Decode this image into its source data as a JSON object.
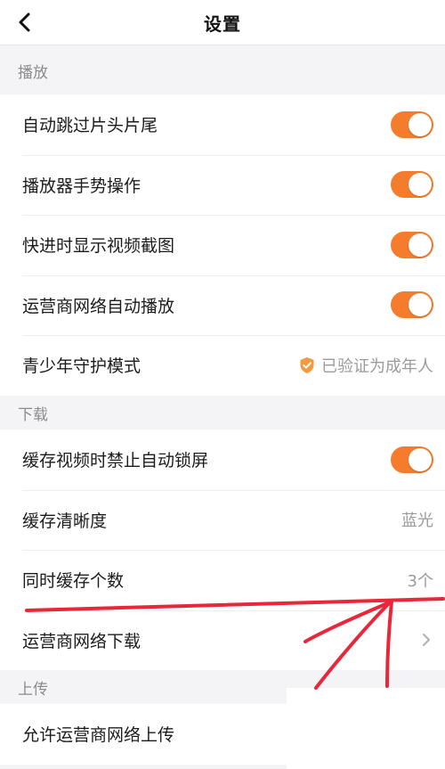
{
  "header": {
    "title": "设置"
  },
  "sections": {
    "playback": {
      "title": "播放",
      "items": [
        {
          "label": "自动跳过片头片尾",
          "toggle": true
        },
        {
          "label": "播放器手势操作",
          "toggle": true
        },
        {
          "label": "快进时显示视频截图",
          "toggle": true
        },
        {
          "label": "运营商网络自动播放",
          "toggle": true
        },
        {
          "label": "青少年守护模式",
          "value": "已验证为成年人",
          "icon": "shield-check-icon"
        }
      ]
    },
    "download": {
      "title": "下载",
      "items": [
        {
          "label": "缓存视频时禁止自动锁屏",
          "toggle": true
        },
        {
          "label": "缓存清晰度",
          "value": "蓝光"
        },
        {
          "label": "同时缓存个数",
          "value": "3个"
        },
        {
          "label": "运营商网络下载",
          "icon": "chevron-right-icon"
        }
      ]
    },
    "upload": {
      "title": "上传",
      "items": [
        {
          "label": "允许运营商网络上传"
        }
      ]
    }
  },
  "colors": {
    "accent": "#f47c2c",
    "annotation": "#e8283a",
    "background": "#f4f4f6"
  }
}
